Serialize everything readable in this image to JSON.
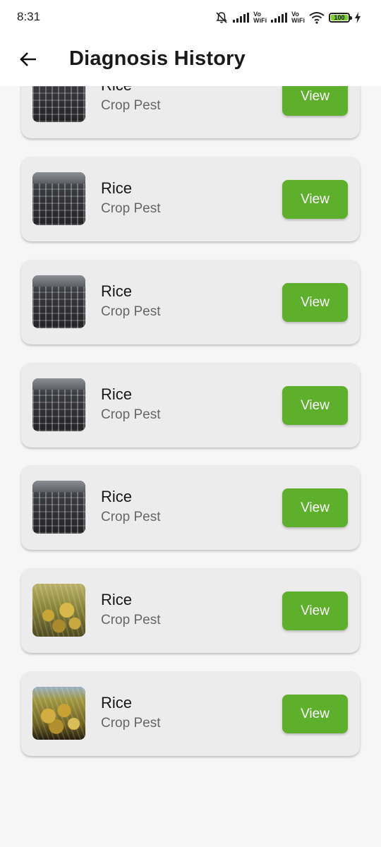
{
  "status_bar": {
    "time": "8:31",
    "battery": "100",
    "vowifi_top": "Vo",
    "vowifi_bottom": "WiFi"
  },
  "app_bar": {
    "title": "Diagnosis History"
  },
  "colors": {
    "accent": "#5daf2c",
    "card_bg": "#ececec",
    "page_bg": "#f6f6f6"
  },
  "items": [
    {
      "name": "Rice",
      "type": "Crop Pest",
      "action": "View",
      "image": "keyboard-photo"
    },
    {
      "name": "Rice",
      "type": "Crop Pest",
      "action": "View",
      "image": "keyboard-photo"
    },
    {
      "name": "Rice",
      "type": "Crop Pest",
      "action": "View",
      "image": "keyboard-photo"
    },
    {
      "name": "Rice",
      "type": "Crop Pest",
      "action": "View",
      "image": "keyboard-photo"
    },
    {
      "name": "Rice",
      "type": "Crop Pest",
      "action": "View",
      "image": "keyboard-photo"
    },
    {
      "name": "Rice",
      "type": "Crop Pest",
      "action": "View",
      "image": "rice-plant-photo"
    },
    {
      "name": "Rice",
      "type": "Crop Pest",
      "action": "View",
      "image": "rice-plant-photo"
    }
  ]
}
